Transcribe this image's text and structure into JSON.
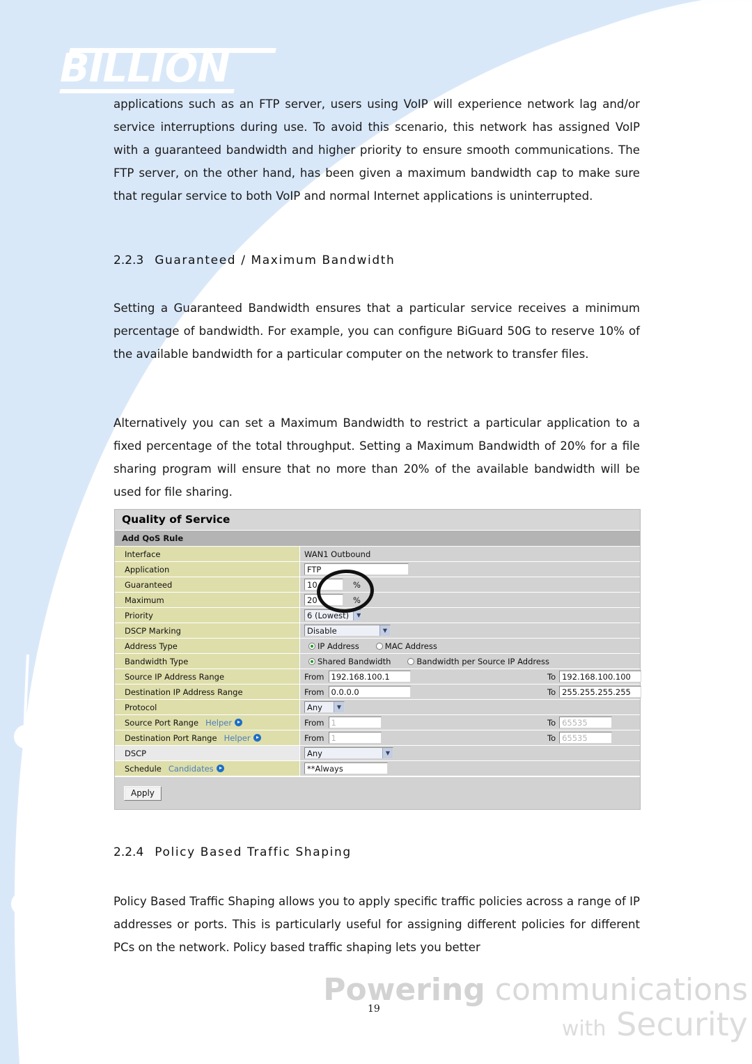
{
  "brand": {
    "logo_text": "BILLION",
    "tagline_line1_bold": "Powering",
    "tagline_line1_light": "communications",
    "tagline_line2_small": "with",
    "tagline_line2_large": "Security"
  },
  "page": {
    "number": "19",
    "paragraphs": {
      "intro": "applications such as an FTP server, users using VoIP will experience network lag and/or service interruptions during use. To avoid this scenario, this network has assigned VoIP with a guaranteed bandwidth and higher priority to ensure smooth communications. The FTP server, on the other hand, has been given a maximum bandwidth cap to make sure that regular service to both VoIP and normal Internet applications is uninterrupted.",
      "guaranteed_body": "Setting a Guaranteed Bandwidth ensures that a particular service receives a minimum percentage of bandwidth. For example, you can configure BiGuard 50G to reserve 10% of the available bandwidth for a particular computer on the network to transfer files.",
      "maximum_body": "Alternatively you can set a Maximum Bandwidth to restrict a particular application to a fixed percentage of the total throughput. Setting a Maximum Bandwidth of 20% for a file sharing program will ensure that no more than 20% of the available bandwidth will be used for file sharing.",
      "policy_body": "Policy Based Traffic Shaping allows you to apply specific traffic policies across a range of IP addresses or ports. This is particularly useful for assigning different policies for different PCs on the network. Policy based traffic shaping lets you better"
    },
    "headings": {
      "sec_223_num": "2.2.3",
      "sec_223_title": "Guaranteed / Maximum Bandwidth",
      "sec_224_num": "2.2.4",
      "sec_224_title": "Policy Based Traffic Shaping"
    }
  },
  "qos": {
    "title": "Quality of Service",
    "subtitle": "Add QoS Rule",
    "labels": {
      "interface": "Interface",
      "application": "Application",
      "guaranteed": "Guaranteed",
      "maximum": "Maximum",
      "priority": "Priority",
      "dscp_marking": "DSCP Marking",
      "address_type": "Address Type",
      "bandwidth_type": "Bandwidth Type",
      "source_ip_range": "Source IP Address Range",
      "destination_ip_range": "Destination IP Address Range",
      "protocol": "Protocol",
      "source_port_range": "Source Port Range",
      "destination_port_range": "Destination Port Range",
      "dscp": "DSCP",
      "schedule": "Schedule"
    },
    "links": {
      "helper": "Helper",
      "candidates": "Candidates"
    },
    "values": {
      "interface": "WAN1 Outbound",
      "application": "FTP",
      "guaranteed": "10",
      "guaranteed_unit": "%",
      "maximum": "20",
      "maximum_unit": "%",
      "priority": "6 (Lowest)",
      "dscp_marking": "Disable",
      "protocol": "Any",
      "dscp": "Any",
      "schedule": "**Always"
    },
    "address_type_options": [
      {
        "label": "IP Address",
        "selected": true
      },
      {
        "label": "MAC Address",
        "selected": false
      }
    ],
    "bandwidth_type_options": [
      {
        "label": "Shared Bandwidth",
        "selected": true
      },
      {
        "label": "Bandwidth per Source IP Address",
        "selected": false
      }
    ],
    "ranges": {
      "from_label": "From",
      "to_label": "To",
      "source_ip_from": "192.168.100.1",
      "source_ip_to": "192.168.100.100",
      "dest_ip_from": "0.0.0.0",
      "dest_ip_to": "255.255.255.255",
      "source_port_from": "1",
      "source_port_to": "65535",
      "dest_port_from": "1",
      "dest_port_to": "65535"
    },
    "apply_button": "Apply",
    "colors": {
      "label_column": "#dedeab",
      "value_column": "#d2d2d2",
      "title_bar": "#d6d6d6",
      "subtitle_bar": "#b4b4b4",
      "link": "#4a7ebb",
      "radio_selected": "#1f9b1f"
    }
  }
}
